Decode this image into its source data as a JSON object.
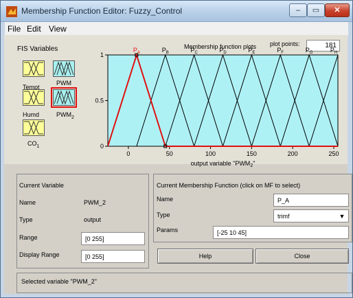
{
  "window": {
    "title": "Membership Function Editor: Fuzzy_Control",
    "controls": {
      "minimize": "–",
      "maximize": "▭",
      "close": "✕"
    }
  },
  "menu": [
    "File",
    "Edit",
    "View"
  ],
  "fis_panel": {
    "title": "FIS Variables",
    "variables": [
      {
        "name": "Tempt",
        "type": "input",
        "selected": false
      },
      {
        "name": "PWM",
        "type": "output",
        "selected": false
      },
      {
        "name": "Humd",
        "type": "input",
        "selected": false
      },
      {
        "name": "PWM",
        "sub": "2",
        "type": "output",
        "selected": true
      },
      {
        "name": "CO",
        "sub": "1",
        "type": "input",
        "selected": false
      }
    ]
  },
  "plot_header": {
    "title": "Membership function plots",
    "points_label": "plot points:",
    "points_value": "181"
  },
  "chart_data": {
    "type": "line",
    "xlim": [
      -25,
      255
    ],
    "ylim": [
      0,
      1
    ],
    "x_ticks": [
      "0",
      "50",
      "100",
      "150",
      "200",
      "250"
    ],
    "y_ticks": [
      "0",
      "0.5",
      "1"
    ],
    "xlabel_prefix": "output variable \"PWM",
    "xlabel_sub": "2",
    "xlabel_suffix": "\"",
    "background": "#aef1f5",
    "line_color": "#000000",
    "selected_color": "#e01010",
    "series": [
      {
        "name": "P",
        "sub": "A",
        "params": [
          -25,
          10,
          45
        ],
        "selected": true
      },
      {
        "name": "P",
        "sub": "B",
        "params": [
          10,
          45,
          80
        ],
        "selected": false
      },
      {
        "name": "P",
        "sub": "C",
        "params": [
          45,
          80,
          115
        ],
        "selected": false
      },
      {
        "name": "P",
        "sub": "D",
        "params": [
          80,
          115,
          150
        ],
        "selected": false
      },
      {
        "name": "P",
        "sub": "E",
        "params": [
          115,
          150,
          185
        ],
        "selected": false
      },
      {
        "name": "P",
        "sub": "F",
        "params": [
          150,
          185,
          220
        ],
        "selected": false
      },
      {
        "name": "P",
        "sub": "G",
        "params": [
          185,
          220,
          255
        ],
        "selected": false
      },
      {
        "name": "P",
        "sub": "H",
        "params": [
          220,
          255,
          290
        ],
        "selected": false
      }
    ]
  },
  "current_variable": {
    "title": "Current Variable",
    "name_label": "Name",
    "name_value": "PWM_2",
    "type_label": "Type",
    "type_value": "output",
    "range_label": "Range",
    "range_value": "[0 255]",
    "display_range_label": "Display Range",
    "display_range_value": "[0 255]"
  },
  "current_mf": {
    "title": "Current Membership Function (click on MF to select)",
    "name_label": "Name",
    "name_value": "P_A",
    "type_label": "Type",
    "type_value": "trimf",
    "params_label": "Params",
    "params_value": "[-25 10 45]"
  },
  "buttons": {
    "help": "Help",
    "close": "Close"
  },
  "status": "Selected variable \"PWM_2\""
}
